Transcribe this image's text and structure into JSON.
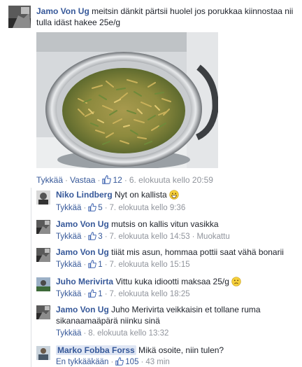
{
  "post": {
    "author": "Jamo Von Ug",
    "text": "meitsin dänkit pärtsii huolel jos porukkaa kiinnostaa nii tulla idäst hakee 25e/g",
    "like": "Tykkää",
    "reply": "Vastaa",
    "likes": "12",
    "time": "6. elokuuta kello 20:59"
  },
  "replies": [
    {
      "author": "Niko Lindberg",
      "text": "Nyt on kallista",
      "emoji": "grinning-face-icon",
      "like": "Tykkää",
      "likes": "5",
      "time": "7. elokuuta kello 9:36"
    },
    {
      "author": "Jamo Von Ug",
      "text": "mutsis on kallis vitun vasikka",
      "like": "Tykkää",
      "likes": "3",
      "time": "7. elokuuta kello 14:53",
      "edited": "Muokattu"
    },
    {
      "author": "Jamo Von Ug",
      "text": "tiiät mis asun, hommaa pottii saat vähä bonarii",
      "like": "Tykkää",
      "likes": "1",
      "time": "7. elokuuta kello 15:15"
    },
    {
      "author": "Juho Merivirta",
      "text": "Vittu kuka idiootti maksaa 25/g",
      "emoji": "frowning-face-icon",
      "like": "Tykkää",
      "likes": "1",
      "time": "7. elokuuta kello 18:25"
    },
    {
      "author": "Jamo Von Ug",
      "text": "Juho Merivirta veikkaisin et tollane ruma sikanaamaäpärä niinku sinä",
      "like": "Tykkää",
      "time": "8. elokuuta kello 13:32"
    },
    {
      "author": "Marko Fobba Forss",
      "text": "Mikä osoite, niin tulen?",
      "like": "En tykkääkään",
      "likes": "105",
      "time": "43 min"
    }
  ],
  "colors": {
    "link": "#365899",
    "meta": "#90949c",
    "like_blue": "#4267b2"
  }
}
